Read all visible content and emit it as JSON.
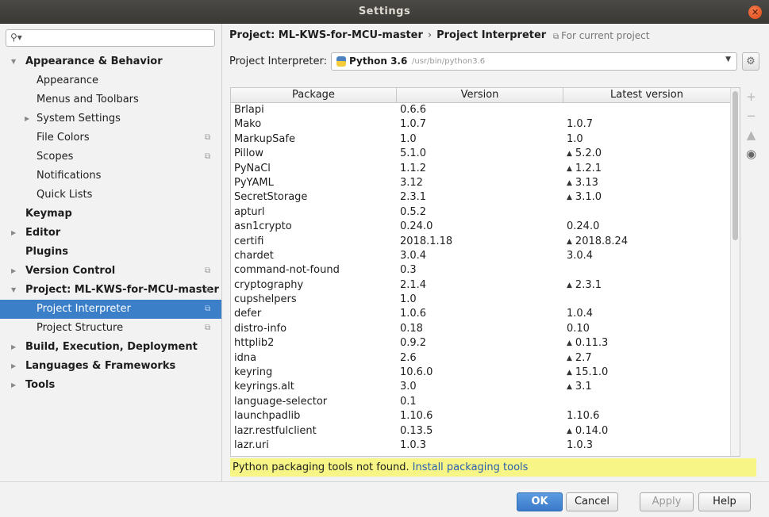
{
  "window": {
    "title": "Settings"
  },
  "search": {
    "placeholder": ""
  },
  "sidebar": {
    "items": [
      {
        "label": "Appearance & Behavior",
        "level": 1,
        "bold": true,
        "arrow": "expanded",
        "copy": false
      },
      {
        "label": "Appearance",
        "level": 2,
        "bold": false,
        "arrow": "",
        "copy": false
      },
      {
        "label": "Menus and Toolbars",
        "level": 2,
        "bold": false,
        "arrow": "",
        "copy": false
      },
      {
        "label": "System Settings",
        "level": 2,
        "bold": false,
        "arrow": "collapsed",
        "copy": false
      },
      {
        "label": "File Colors",
        "level": 2,
        "bold": false,
        "arrow": "",
        "copy": true
      },
      {
        "label": "Scopes",
        "level": 2,
        "bold": false,
        "arrow": "",
        "copy": true
      },
      {
        "label": "Notifications",
        "level": 2,
        "bold": false,
        "arrow": "",
        "copy": false
      },
      {
        "label": "Quick Lists",
        "level": 2,
        "bold": false,
        "arrow": "",
        "copy": false
      },
      {
        "label": "Keymap",
        "level": 1,
        "bold": true,
        "arrow": "",
        "copy": false
      },
      {
        "label": "Editor",
        "level": 1,
        "bold": true,
        "arrow": "collapsed",
        "copy": false
      },
      {
        "label": "Plugins",
        "level": 1,
        "bold": true,
        "arrow": "",
        "copy": false
      },
      {
        "label": "Version Control",
        "level": 1,
        "bold": true,
        "arrow": "collapsed",
        "copy": true
      },
      {
        "label": "Project: ML-KWS-for-MCU-master",
        "level": 1,
        "bold": true,
        "arrow": "expanded",
        "copy": true
      },
      {
        "label": "Project Interpreter",
        "level": 2,
        "bold": false,
        "arrow": "",
        "copy": true,
        "selected": true
      },
      {
        "label": "Project Structure",
        "level": 2,
        "bold": false,
        "arrow": "",
        "copy": true
      },
      {
        "label": "Build, Execution, Deployment",
        "level": 1,
        "bold": true,
        "arrow": "collapsed",
        "copy": false
      },
      {
        "label": "Languages & Frameworks",
        "level": 1,
        "bold": true,
        "arrow": "collapsed",
        "copy": false
      },
      {
        "label": "Tools",
        "level": 1,
        "bold": true,
        "arrow": "collapsed",
        "copy": false
      }
    ]
  },
  "main": {
    "breadcrumb": {
      "project": "Project: ML-KWS-for-MCU-master",
      "separator": "›",
      "page": "Project Interpreter"
    },
    "for_current_project": "For current project",
    "interpreter_label": "Project Interpreter:",
    "interpreter_name": "Python 3.6",
    "interpreter_path": "/usr/bin/python3.6",
    "columns": [
      "Package",
      "Version",
      "Latest version"
    ],
    "packages": [
      {
        "name": "Brlapi",
        "version": "0.6.6",
        "latest": "",
        "upgrade": false
      },
      {
        "name": "Mako",
        "version": "1.0.7",
        "latest": "1.0.7",
        "upgrade": false
      },
      {
        "name": "MarkupSafe",
        "version": "1.0",
        "latest": "1.0",
        "upgrade": false
      },
      {
        "name": "Pillow",
        "version": "5.1.0",
        "latest": "5.2.0",
        "upgrade": true
      },
      {
        "name": "PyNaCl",
        "version": "1.1.2",
        "latest": "1.2.1",
        "upgrade": true
      },
      {
        "name": "PyYAML",
        "version": "3.12",
        "latest": "3.13",
        "upgrade": true
      },
      {
        "name": "SecretStorage",
        "version": "2.3.1",
        "latest": "3.1.0",
        "upgrade": true
      },
      {
        "name": "apturl",
        "version": "0.5.2",
        "latest": "",
        "upgrade": false
      },
      {
        "name": "asn1crypto",
        "version": "0.24.0",
        "latest": "0.24.0",
        "upgrade": false
      },
      {
        "name": "certifi",
        "version": "2018.1.18",
        "latest": "2018.8.24",
        "upgrade": true
      },
      {
        "name": "chardet",
        "version": "3.0.4",
        "latest": "3.0.4",
        "upgrade": false
      },
      {
        "name": "command-not-found",
        "version": "0.3",
        "latest": "",
        "upgrade": false
      },
      {
        "name": "cryptography",
        "version": "2.1.4",
        "latest": "2.3.1",
        "upgrade": true
      },
      {
        "name": "cupshelpers",
        "version": "1.0",
        "latest": "",
        "upgrade": false
      },
      {
        "name": "defer",
        "version": "1.0.6",
        "latest": "1.0.4",
        "upgrade": false
      },
      {
        "name": "distro-info",
        "version": "0.18",
        "latest": "0.10",
        "upgrade": false
      },
      {
        "name": "httplib2",
        "version": "0.9.2",
        "latest": "0.11.3",
        "upgrade": true
      },
      {
        "name": "idna",
        "version": "2.6",
        "latest": "2.7",
        "upgrade": true
      },
      {
        "name": "keyring",
        "version": "10.6.0",
        "latest": "15.1.0",
        "upgrade": true
      },
      {
        "name": "keyrings.alt",
        "version": "3.0",
        "latest": "3.1",
        "upgrade": true
      },
      {
        "name": "language-selector",
        "version": "0.1",
        "latest": "",
        "upgrade": false
      },
      {
        "name": "launchpadlib",
        "version": "1.10.6",
        "latest": "1.10.6",
        "upgrade": false
      },
      {
        "name": "lazr.restfulclient",
        "version": "0.13.5",
        "latest": "0.14.0",
        "upgrade": true
      },
      {
        "name": "lazr.uri",
        "version": "1.0.3",
        "latest": "1.0.3",
        "upgrade": false
      }
    ],
    "warning_text": "Python packaging tools not found.",
    "warning_link": "Install packaging tools",
    "side_buttons": [
      {
        "name": "add-package-button",
        "glyph": "+"
      },
      {
        "name": "remove-package-button",
        "glyph": "−"
      },
      {
        "name": "upgrade-package-button",
        "glyph": "▲"
      },
      {
        "name": "show-details-button",
        "glyph": "◉"
      }
    ]
  },
  "footer": {
    "ok": "OK",
    "cancel": "Cancel",
    "apply": "Apply",
    "help": "Help"
  },
  "colors": {
    "selection": "#3c7fc9",
    "warning_bg": "#f6f586",
    "link": "#2a5fb0",
    "titlebar": "#3e3d39",
    "close": "#e5541e"
  }
}
